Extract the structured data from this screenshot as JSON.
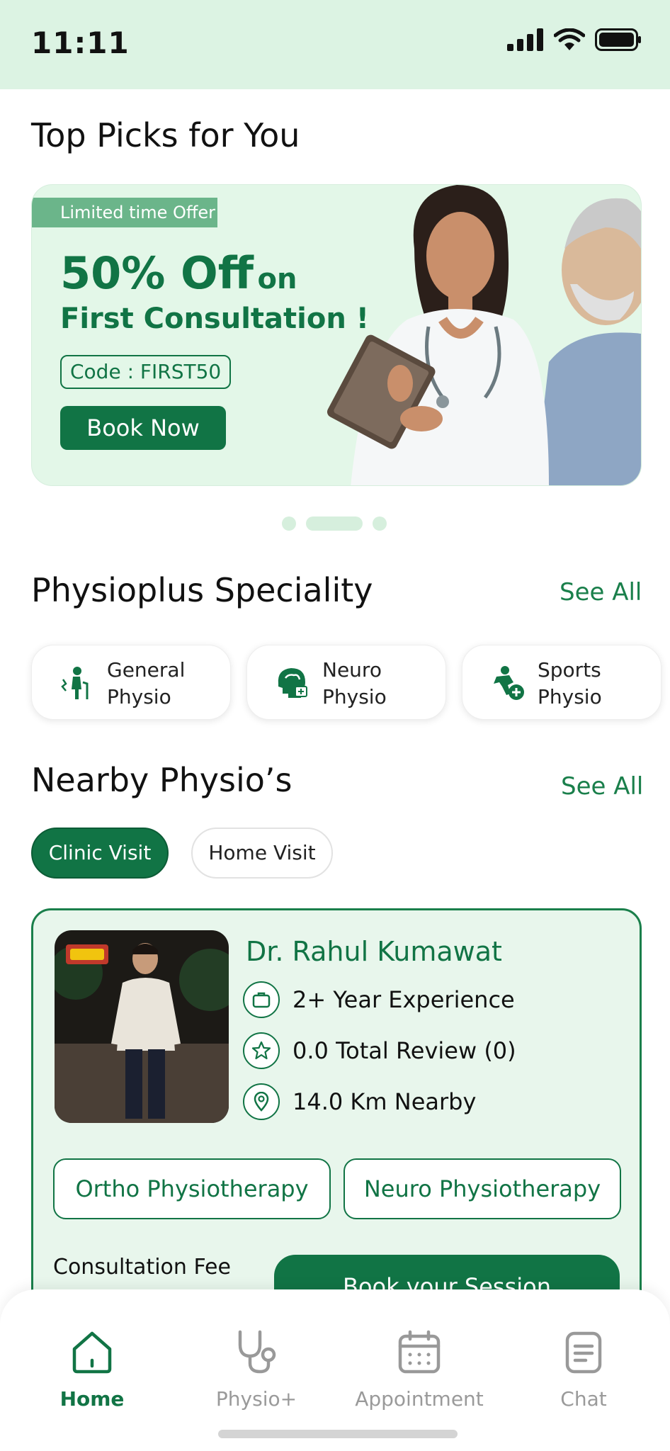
{
  "status_bar": {
    "time": "11:11"
  },
  "top_picks": {
    "title": "Top Picks for You",
    "banner": {
      "tag": "Limited time Offer",
      "headline_big": "50% Off",
      "headline_small": "on",
      "subtitle": "First Consultation !",
      "code": "Code : FIRST50",
      "button": "Book Now"
    },
    "carousel_active_index": 1,
    "carousel_count": 3
  },
  "speciality": {
    "title": "Physioplus Speciality",
    "see_all": "See All",
    "items": [
      {
        "line1": "General",
        "line2": "Physio",
        "icon": "elderly-person-icon"
      },
      {
        "line1": "Neuro",
        "line2": "Physio",
        "icon": "brain-head-icon"
      },
      {
        "line1": "Sports",
        "line2": "Physio",
        "icon": "sports-injury-icon"
      }
    ]
  },
  "nearby": {
    "title": "Nearby Physio’s",
    "see_all": "See All",
    "chips": [
      "Clinic Visit",
      "Home Visit"
    ],
    "doctor": {
      "name": "Dr. Rahul Kumawat",
      "experience": "2+ Year Experience",
      "review": "0.0 Total Review (0)",
      "distance": "14.0 Km Nearby",
      "tags": [
        "Ortho Physiotherapy",
        "Neuro Physiotherapy"
      ],
      "fee_label": "Consultation Fee",
      "book_button": "Book your Session"
    }
  },
  "bottom_nav": {
    "items": [
      {
        "label": "Home",
        "icon": "home-icon"
      },
      {
        "label": "Physio+",
        "icon": "stethoscope-icon"
      },
      {
        "label": "Appointment",
        "icon": "calendar-icon"
      },
      {
        "label": "Chat",
        "icon": "chat-icon"
      }
    ],
    "active_index": 0
  },
  "colors": {
    "brand": "#117445",
    "banner_bg": "#e3f7e8",
    "status_bg": "#dcf3e3",
    "card_bg": "#e8f6ec"
  }
}
